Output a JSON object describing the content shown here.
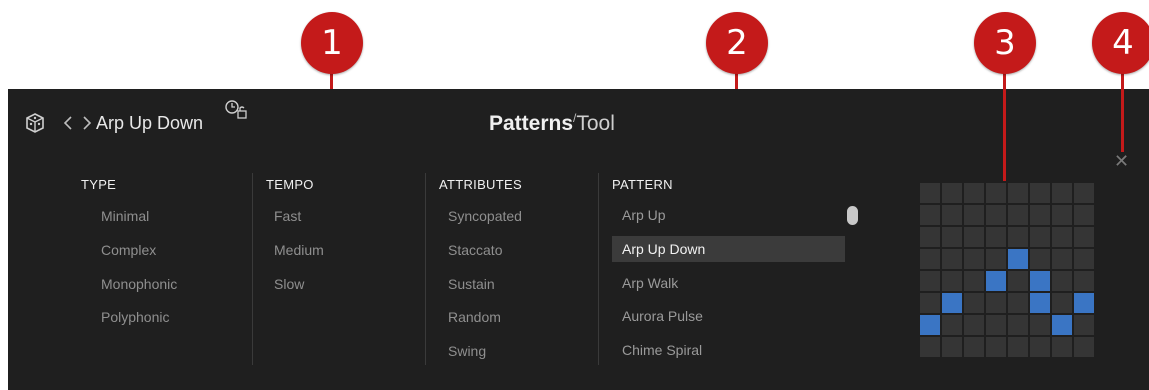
{
  "callouts": [
    {
      "number": "1"
    },
    {
      "number": "2"
    },
    {
      "number": "3"
    },
    {
      "number": "4"
    }
  ],
  "header": {
    "preset_name": "Arp Up Down",
    "title_bold": "Patterns",
    "title_separator": "/",
    "title_light": "Tool",
    "icons": [
      "dice-icon",
      "chevron-left-icon",
      "chevron-right-icon",
      "stopwatch-lock-icon"
    ]
  },
  "filters": {
    "type": {
      "header": "TYPE",
      "items": [
        "Minimal",
        "Complex",
        "Monophonic",
        "Polyphonic"
      ]
    },
    "tempo": {
      "header": "TEMPO",
      "items": [
        "Fast",
        "Medium",
        "Slow"
      ]
    },
    "attributes": {
      "header": "ATTRIBUTES",
      "items": [
        "Syncopated",
        "Staccato",
        "Sustain",
        "Random",
        "Swing"
      ]
    }
  },
  "patterns": {
    "header": "PATTERN",
    "items": [
      "Arp Up",
      "Arp Up Down",
      "Arp Walk",
      "Aurora Pulse",
      "Chime Spiral"
    ],
    "selected": "Arp Up Down"
  },
  "preview": {
    "rows": 8,
    "cols": 8,
    "active_cells": [
      [
        3,
        4
      ],
      [
        4,
        3
      ],
      [
        4,
        5
      ],
      [
        5,
        1
      ],
      [
        5,
        5
      ],
      [
        5,
        7
      ],
      [
        6,
        0
      ],
      [
        6,
        6
      ]
    ]
  },
  "colors": {
    "callout": "#c41a1a",
    "panel": "#1f1f1f",
    "accent": "#3a75c4",
    "selected_row": "#3b3b3b"
  }
}
